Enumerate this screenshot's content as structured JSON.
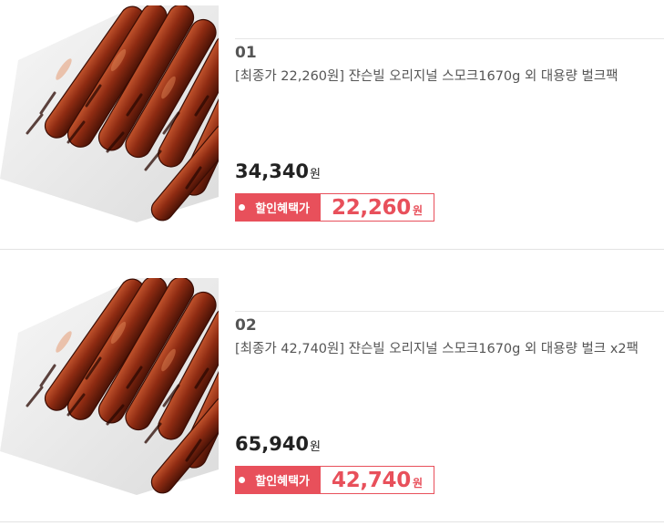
{
  "products": [
    {
      "rank": "01",
      "title": "[최종가 22,260원] 쟌슨빌 오리지널 스모크1670g 외 대용량 벌크팩",
      "price": "34,340",
      "price_unit": "원",
      "deal_label": "할인혜택가",
      "deal_price": "22,260",
      "deal_unit": "원",
      "image": "grilled-sausages"
    },
    {
      "rank": "02",
      "title": "[최종가 42,740원] 쟌슨빌 오리지널 스모크1670g 외 대용량 벌크 x2팩",
      "price": "65,940",
      "price_unit": "원",
      "deal_label": "할인혜택가",
      "deal_price": "42,740",
      "deal_unit": "원",
      "image": "grilled-sausages"
    }
  ],
  "colors": {
    "accent": "#e8505b",
    "text_dark": "#222222",
    "text_muted": "#555555",
    "divider": "#e3e3e3"
  }
}
